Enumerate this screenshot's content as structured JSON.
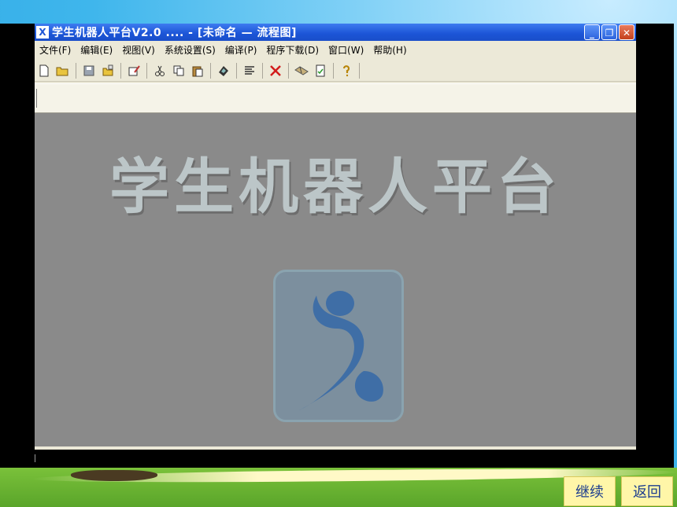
{
  "window": {
    "title": "学生机器人平台V2.0 .... - [未命名 — 流程图]",
    "app_icon": "X",
    "minimize_glyph": "_",
    "restore_glyph": "❐",
    "close_glyph": "✕"
  },
  "menu": [
    {
      "label": "文件(F)"
    },
    {
      "label": "编辑(E)"
    },
    {
      "label": "视图(V)"
    },
    {
      "label": "系统设置(S)"
    },
    {
      "label": "编译(P)"
    },
    {
      "label": "程序下载(D)"
    },
    {
      "label": "窗口(W)"
    },
    {
      "label": "帮助(H)"
    }
  ],
  "toolbar_icons": [
    "new-file-icon",
    "open-folder-icon",
    "save-icon",
    "save-all-icon",
    "edit-icon",
    "cut-icon",
    "copy-icon",
    "paste-icon",
    "chip-icon",
    "list-icon",
    "delete-icon",
    "download-icon",
    "document-icon",
    "help-icon"
  ],
  "splash": {
    "title": "学生机器人平台"
  },
  "nav": {
    "continue_label": "继续",
    "back_label": "返回"
  },
  "colors": {
    "titlebar": "#1b54d6",
    "canvas": "#8a8a8a",
    "logo_figure": "#3f6ea6",
    "nav_button": "#fff6a8",
    "nav_text": "#1b3c8e"
  }
}
